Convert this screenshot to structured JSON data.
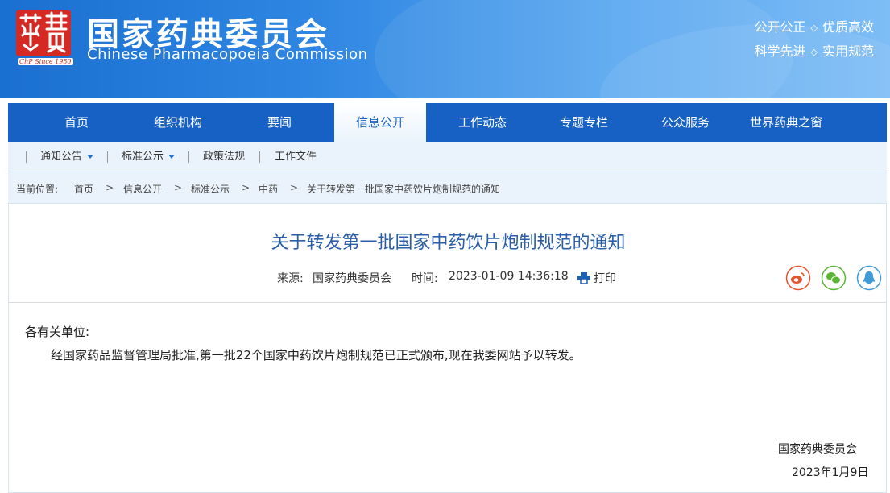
{
  "header": {
    "logo_seal_text": "藥典",
    "logo_subtitle": "ChP Since 1950",
    "title": "国家药典委员会",
    "title_en": "Chinese Pharmacopoeia Commission",
    "motto_1a": "公开公正",
    "motto_1b": "优质高效",
    "motto_2a": "科学先进",
    "motto_2b": "实用规范",
    "motto_sep": "◇"
  },
  "nav": {
    "items": [
      {
        "label": "首页"
      },
      {
        "label": "组织机构"
      },
      {
        "label": "要闻"
      },
      {
        "label": "信息公开"
      },
      {
        "label": "工作动态"
      },
      {
        "label": "专题专栏"
      },
      {
        "label": "公众服务"
      },
      {
        "label": "世界药典之窗"
      }
    ],
    "active": "信息公开"
  },
  "subnav": {
    "items": [
      {
        "label": "通知公告"
      },
      {
        "label": "标准公示"
      },
      {
        "label": "政策法规"
      },
      {
        "label": "工作文件"
      }
    ]
  },
  "breadcrumb": {
    "prefix": "当前位置:",
    "items": [
      "首页",
      "信息公开",
      "标准公示",
      "中药",
      "关于转发第一批国家中药饮片炮制规范的通知"
    ],
    "sep": ">"
  },
  "article": {
    "title": "关于转发第一批国家中药饮片炮制规范的通知",
    "source_label": "来源:",
    "source": "国家药典委员会",
    "time_label": "时间:",
    "time": "2023-01-09 14:36:18",
    "print_label": "打印",
    "salutation": "各有关单位:",
    "body": "经国家药品监督管理局批准,第一批22个国家中药饮片炮制规范已正式颁布,现在我委网站予以转发。",
    "signature": "国家药典委员会",
    "date": "2023年1月9日"
  },
  "share": {
    "icons": [
      "weibo-icon",
      "wechat-icon",
      "qq-icon"
    ],
    "colors": {
      "weibo": "#e5542a",
      "wechat": "#5ab534",
      "qq": "#3e9bd6"
    }
  },
  "colors": {
    "nav_bg": "#1861c4",
    "title_blue": "#2a5ea8",
    "subnav_bg": "#eaf3fc"
  }
}
